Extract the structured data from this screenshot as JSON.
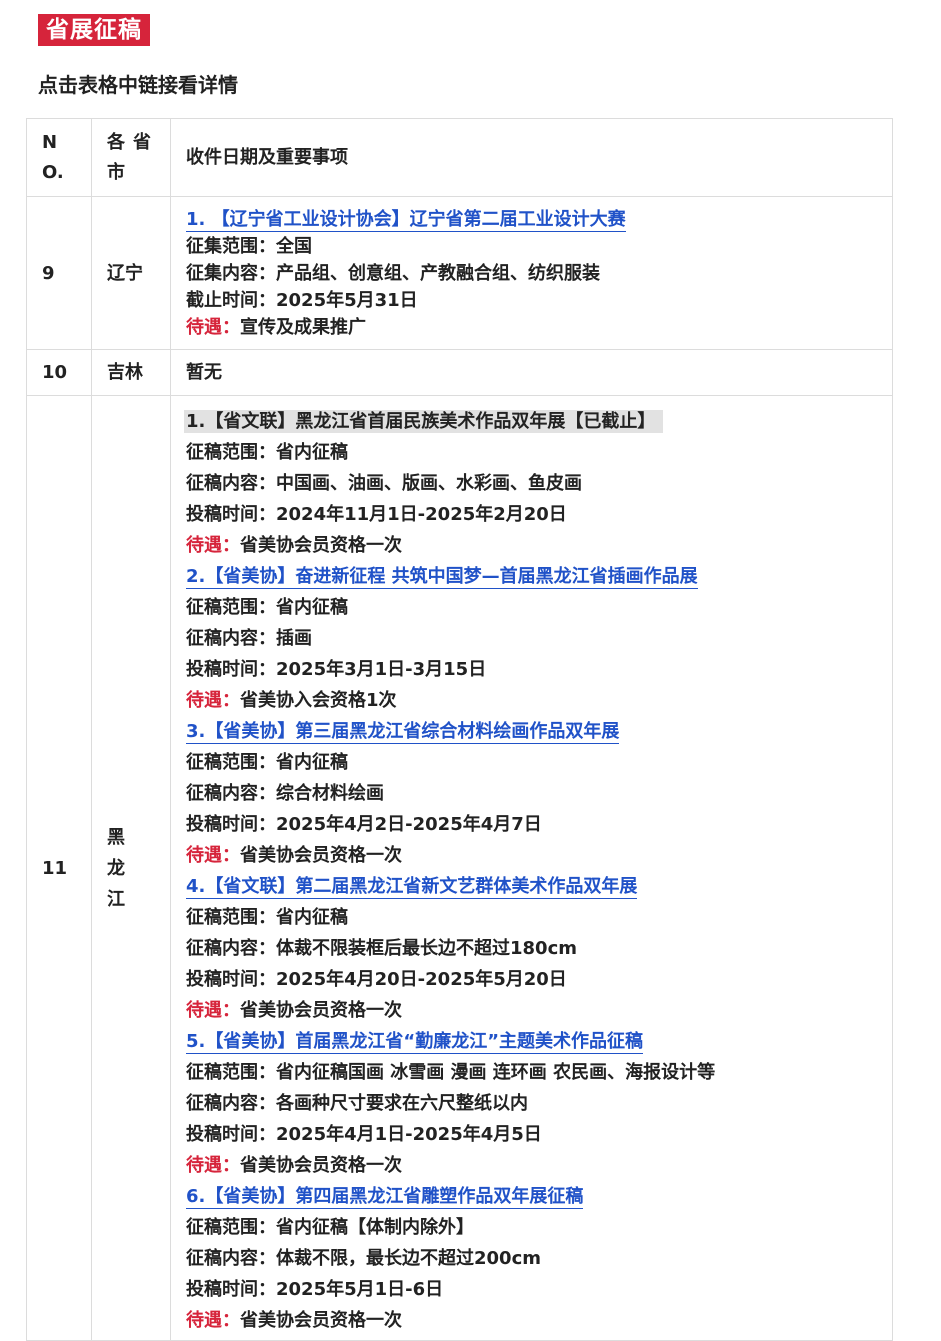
{
  "header": {
    "section_tag": "省展征稿",
    "subtitle": "点击表格中链接看详情"
  },
  "table": {
    "columns": {
      "no_line1": "N",
      "no_line2": "O.",
      "prov_line1": "各省",
      "prov_line2": "市",
      "main": "收件日期及重要事项"
    },
    "rows": [
      {
        "no": "9",
        "province": "辽宁",
        "entries": [
          {
            "title": "1. 【辽宁省工业设计协会】辽宁省第二届工业设计大赛",
            "lines": [
              "征集范围：全国",
              "征集内容：产品组、创意组、产教融合组、纺织服装",
              "截止时间：2025年5月31日"
            ],
            "reward_label": "待遇：",
            "reward_text": "宣传及成果推广"
          }
        ]
      },
      {
        "no": "10",
        "province": "吉林",
        "text": "暂无"
      },
      {
        "no": "11",
        "province_chars": [
          "黑",
          "龙",
          "江"
        ],
        "entries": [
          {
            "title": "1.【省文联】黑龙江省首届民族美术作品双年展【已截止】",
            "lines": [
              "征稿范围：省内征稿",
              "征稿内容：中国画、油画、版画、水彩画、鱼皮画",
              "投稿时间：2024年11月1日-2025年2月20日"
            ],
            "reward_label": "待遇：",
            "reward_text": "省美协会员资格一次"
          },
          {
            "title": "2.【省美协】奋进新征程 共筑中国梦—首届黑龙江省插画作品展",
            "lines": [
              "征稿范围：省内征稿",
              "征稿内容：插画",
              "投稿时间：2025年3月1日-3月15日"
            ],
            "reward_label": "待遇：",
            "reward_text": "省美协入会资格1次"
          },
          {
            "title": "3.【省美协】第三届黑龙江省综合材料绘画作品双年展",
            "lines": [
              "征稿范围：省内征稿",
              "征稿内容：综合材料绘画",
              "投稿时间：2025年4月2日-2025年4月7日"
            ],
            "reward_label": "待遇：",
            "reward_text": "省美协会员资格一次"
          },
          {
            "title": "4.【省文联】第二届黑龙江省新文艺群体美术作品双年展",
            "lines": [
              "征稿范围：省内征稿",
              "征稿内容：体裁不限装框后最长边不超过180cm",
              "投稿时间：2025年4月20日-2025年5月20日"
            ],
            "reward_label": "待遇：",
            "reward_text": "省美协会员资格一次"
          },
          {
            "title": "5.【省美协】首届黑龙江省“勤廉龙江”主题美术作品征稿",
            "lines": [
              "征稿范围：省内征稿国画 冰雪画 漫画 连环画 农民画、海报设计等",
              "征稿内容：各画种尺寸要求在六尺整纸以内",
              "投稿时间：2025年4月1日-2025年4月5日"
            ],
            "reward_label": "待遇：",
            "reward_text": "省美协会员资格一次"
          },
          {
            "title": "6.【省美协】第四届黑龙江省雕塑作品双年展征稿",
            "lines": [
              "征稿范围：省内征稿【体制内除外】",
              "征稿内容：体裁不限，最长边不超过200cm",
              "投稿时间：2025年5月1日-6日"
            ],
            "reward_label": "待遇：",
            "reward_text": "省美协会员资格一次"
          }
        ]
      }
    ]
  },
  "colors": {
    "tag_background": "#d6243b",
    "link": "#2052c8",
    "reward_label": "#d6243b",
    "closed_highlight": "#e2e2e2",
    "border": "#dcdcdc"
  }
}
